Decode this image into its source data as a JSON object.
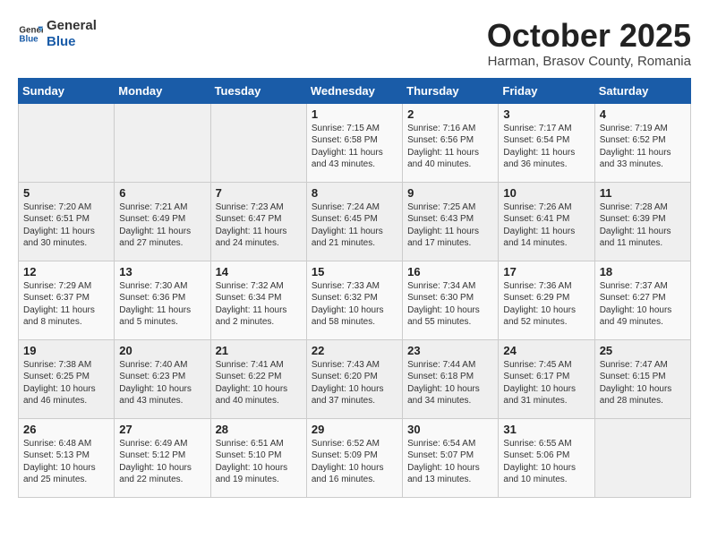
{
  "header": {
    "logo_general": "General",
    "logo_blue": "Blue",
    "month": "October 2025",
    "location": "Harman, Brasov County, Romania"
  },
  "weekdays": [
    "Sunday",
    "Monday",
    "Tuesday",
    "Wednesday",
    "Thursday",
    "Friday",
    "Saturday"
  ],
  "weeks": [
    [
      {
        "day": "",
        "sunrise": "",
        "sunset": "",
        "daylight": ""
      },
      {
        "day": "",
        "sunrise": "",
        "sunset": "",
        "daylight": ""
      },
      {
        "day": "",
        "sunrise": "",
        "sunset": "",
        "daylight": ""
      },
      {
        "day": "1",
        "sunrise": "Sunrise: 7:15 AM",
        "sunset": "Sunset: 6:58 PM",
        "daylight": "Daylight: 11 hours and 43 minutes."
      },
      {
        "day": "2",
        "sunrise": "Sunrise: 7:16 AM",
        "sunset": "Sunset: 6:56 PM",
        "daylight": "Daylight: 11 hours and 40 minutes."
      },
      {
        "day": "3",
        "sunrise": "Sunrise: 7:17 AM",
        "sunset": "Sunset: 6:54 PM",
        "daylight": "Daylight: 11 hours and 36 minutes."
      },
      {
        "day": "4",
        "sunrise": "Sunrise: 7:19 AM",
        "sunset": "Sunset: 6:52 PM",
        "daylight": "Daylight: 11 hours and 33 minutes."
      }
    ],
    [
      {
        "day": "5",
        "sunrise": "Sunrise: 7:20 AM",
        "sunset": "Sunset: 6:51 PM",
        "daylight": "Daylight: 11 hours and 30 minutes."
      },
      {
        "day": "6",
        "sunrise": "Sunrise: 7:21 AM",
        "sunset": "Sunset: 6:49 PM",
        "daylight": "Daylight: 11 hours and 27 minutes."
      },
      {
        "day": "7",
        "sunrise": "Sunrise: 7:23 AM",
        "sunset": "Sunset: 6:47 PM",
        "daylight": "Daylight: 11 hours and 24 minutes."
      },
      {
        "day": "8",
        "sunrise": "Sunrise: 7:24 AM",
        "sunset": "Sunset: 6:45 PM",
        "daylight": "Daylight: 11 hours and 21 minutes."
      },
      {
        "day": "9",
        "sunrise": "Sunrise: 7:25 AM",
        "sunset": "Sunset: 6:43 PM",
        "daylight": "Daylight: 11 hours and 17 minutes."
      },
      {
        "day": "10",
        "sunrise": "Sunrise: 7:26 AM",
        "sunset": "Sunset: 6:41 PM",
        "daylight": "Daylight: 11 hours and 14 minutes."
      },
      {
        "day": "11",
        "sunrise": "Sunrise: 7:28 AM",
        "sunset": "Sunset: 6:39 PM",
        "daylight": "Daylight: 11 hours and 11 minutes."
      }
    ],
    [
      {
        "day": "12",
        "sunrise": "Sunrise: 7:29 AM",
        "sunset": "Sunset: 6:37 PM",
        "daylight": "Daylight: 11 hours and 8 minutes."
      },
      {
        "day": "13",
        "sunrise": "Sunrise: 7:30 AM",
        "sunset": "Sunset: 6:36 PM",
        "daylight": "Daylight: 11 hours and 5 minutes."
      },
      {
        "day": "14",
        "sunrise": "Sunrise: 7:32 AM",
        "sunset": "Sunset: 6:34 PM",
        "daylight": "Daylight: 11 hours and 2 minutes."
      },
      {
        "day": "15",
        "sunrise": "Sunrise: 7:33 AM",
        "sunset": "Sunset: 6:32 PM",
        "daylight": "Daylight: 10 hours and 58 minutes."
      },
      {
        "day": "16",
        "sunrise": "Sunrise: 7:34 AM",
        "sunset": "Sunset: 6:30 PM",
        "daylight": "Daylight: 10 hours and 55 minutes."
      },
      {
        "day": "17",
        "sunrise": "Sunrise: 7:36 AM",
        "sunset": "Sunset: 6:29 PM",
        "daylight": "Daylight: 10 hours and 52 minutes."
      },
      {
        "day": "18",
        "sunrise": "Sunrise: 7:37 AM",
        "sunset": "Sunset: 6:27 PM",
        "daylight": "Daylight: 10 hours and 49 minutes."
      }
    ],
    [
      {
        "day": "19",
        "sunrise": "Sunrise: 7:38 AM",
        "sunset": "Sunset: 6:25 PM",
        "daylight": "Daylight: 10 hours and 46 minutes."
      },
      {
        "day": "20",
        "sunrise": "Sunrise: 7:40 AM",
        "sunset": "Sunset: 6:23 PM",
        "daylight": "Daylight: 10 hours and 43 minutes."
      },
      {
        "day": "21",
        "sunrise": "Sunrise: 7:41 AM",
        "sunset": "Sunset: 6:22 PM",
        "daylight": "Daylight: 10 hours and 40 minutes."
      },
      {
        "day": "22",
        "sunrise": "Sunrise: 7:43 AM",
        "sunset": "Sunset: 6:20 PM",
        "daylight": "Daylight: 10 hours and 37 minutes."
      },
      {
        "day": "23",
        "sunrise": "Sunrise: 7:44 AM",
        "sunset": "Sunset: 6:18 PM",
        "daylight": "Daylight: 10 hours and 34 minutes."
      },
      {
        "day": "24",
        "sunrise": "Sunrise: 7:45 AM",
        "sunset": "Sunset: 6:17 PM",
        "daylight": "Daylight: 10 hours and 31 minutes."
      },
      {
        "day": "25",
        "sunrise": "Sunrise: 7:47 AM",
        "sunset": "Sunset: 6:15 PM",
        "daylight": "Daylight: 10 hours and 28 minutes."
      }
    ],
    [
      {
        "day": "26",
        "sunrise": "Sunrise: 6:48 AM",
        "sunset": "Sunset: 5:13 PM",
        "daylight": "Daylight: 10 hours and 25 minutes."
      },
      {
        "day": "27",
        "sunrise": "Sunrise: 6:49 AM",
        "sunset": "Sunset: 5:12 PM",
        "daylight": "Daylight: 10 hours and 22 minutes."
      },
      {
        "day": "28",
        "sunrise": "Sunrise: 6:51 AM",
        "sunset": "Sunset: 5:10 PM",
        "daylight": "Daylight: 10 hours and 19 minutes."
      },
      {
        "day": "29",
        "sunrise": "Sunrise: 6:52 AM",
        "sunset": "Sunset: 5:09 PM",
        "daylight": "Daylight: 10 hours and 16 minutes."
      },
      {
        "day": "30",
        "sunrise": "Sunrise: 6:54 AM",
        "sunset": "Sunset: 5:07 PM",
        "daylight": "Daylight: 10 hours and 13 minutes."
      },
      {
        "day": "31",
        "sunrise": "Sunrise: 6:55 AM",
        "sunset": "Sunset: 5:06 PM",
        "daylight": "Daylight: 10 hours and 10 minutes."
      },
      {
        "day": "",
        "sunrise": "",
        "sunset": "",
        "daylight": ""
      }
    ]
  ]
}
